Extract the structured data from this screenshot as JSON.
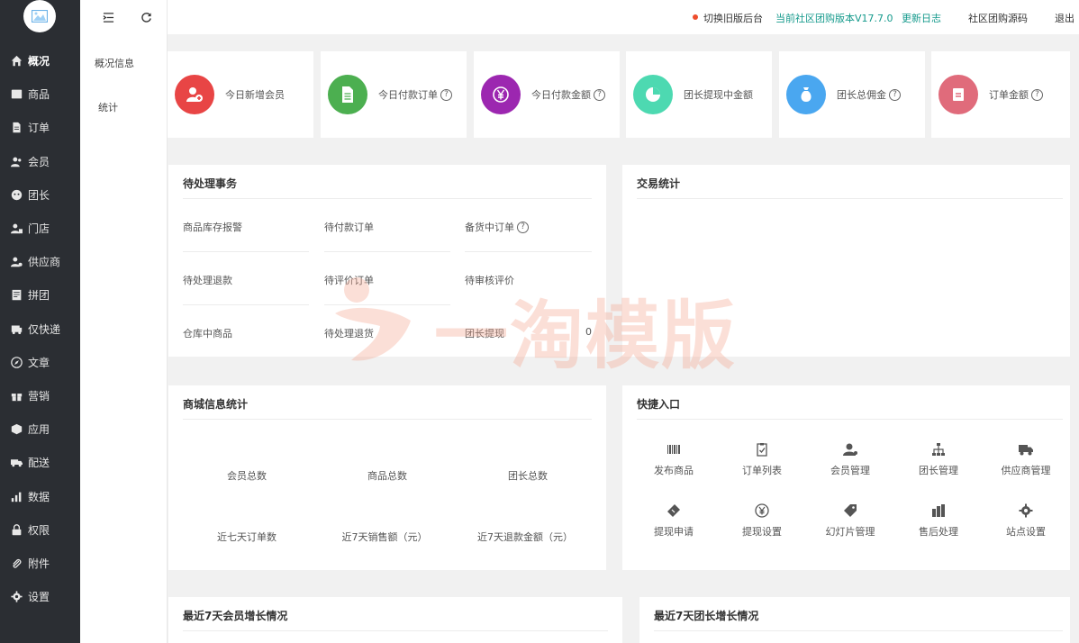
{
  "sidebar": {
    "logo_icon": "image-icon",
    "items": [
      {
        "label": "概况",
        "icon": "home-icon",
        "active": true
      },
      {
        "label": "商品",
        "icon": "goods-icon"
      },
      {
        "label": "订单",
        "icon": "order-icon"
      },
      {
        "label": "会员",
        "icon": "member-icon"
      },
      {
        "label": "团长",
        "icon": "leader-icon"
      },
      {
        "label": "门店",
        "icon": "store-icon"
      },
      {
        "label": "供应商",
        "icon": "supplier-icon"
      },
      {
        "label": "拼团",
        "icon": "group-icon"
      },
      {
        "label": "仅快递",
        "icon": "express-icon"
      },
      {
        "label": "文章",
        "icon": "article-icon"
      },
      {
        "label": "营销",
        "icon": "gift-icon"
      },
      {
        "label": "应用",
        "icon": "app-icon"
      },
      {
        "label": "配送",
        "icon": "truck-icon"
      },
      {
        "label": "数据",
        "icon": "data-icon"
      },
      {
        "label": "权限",
        "icon": "lock-icon"
      },
      {
        "label": "附件",
        "icon": "attach-icon"
      },
      {
        "label": "设置",
        "icon": "gear-icon"
      }
    ]
  },
  "submenu": {
    "items": [
      "概况信息",
      "统计"
    ]
  },
  "topbar": {
    "switch_old": "切换旧版后台",
    "version": "当前社区团购版本V17.7.0",
    "changelog": "更新日志",
    "source": "社区团购源码",
    "logout": "退出",
    "colors": {
      "link": "#159a8c",
      "dot": "#ee4d2d"
    }
  },
  "stats": [
    {
      "label": "今日新增会员",
      "color": "#e84545",
      "icon": "add-user-icon",
      "help": false
    },
    {
      "label": "今日付款订单",
      "color": "#4caf50",
      "icon": "document-icon",
      "help": true
    },
    {
      "label": "今日付款金额",
      "color": "#9c27b0",
      "icon": "yen-icon",
      "help": true
    },
    {
      "label": "团长提现中金额",
      "color": "#4dd9b1",
      "icon": "pie-icon",
      "help": false
    },
    {
      "label": "团长总佣金",
      "color": "#4aa7f0",
      "icon": "money-bag-icon",
      "help": true
    },
    {
      "label": "订单金额",
      "color": "#e06b7b",
      "icon": "receipt-icon",
      "help": true
    }
  ],
  "help_mark": "?",
  "pending": {
    "title": "待处理事务",
    "items": [
      {
        "label": "商品库存报警"
      },
      {
        "label": "待付款订单"
      },
      {
        "label": "备货中订单",
        "help": true
      },
      {
        "label": "待处理退款"
      },
      {
        "label": "待评价订单"
      },
      {
        "label": "待审核评价"
      },
      {
        "label": "仓库中商品"
      },
      {
        "label": "待处理退货"
      },
      {
        "label": "团长提现",
        "value": "0"
      }
    ]
  },
  "trade": {
    "title": "交易统计"
  },
  "mall": {
    "title": "商城信息统计",
    "items": [
      "会员总数",
      "商品总数",
      "团长总数",
      "近七天订单数",
      "近7天销售额（元）",
      "近7天退款金额（元）"
    ]
  },
  "quick": {
    "title": "快捷入口",
    "items": [
      {
        "label": "发布商品",
        "icon": "barcode-icon"
      },
      {
        "label": "订单列表",
        "icon": "clipboard-check-icon"
      },
      {
        "label": "会员管理",
        "icon": "member-manage-icon"
      },
      {
        "label": "团长管理",
        "icon": "sitemap-icon"
      },
      {
        "label": "供应商管理",
        "icon": "truck-icon"
      },
      {
        "label": "提现申请",
        "icon": "ticket-icon"
      },
      {
        "label": "提现设置",
        "icon": "yen-circle-icon"
      },
      {
        "label": "幻灯片管理",
        "icon": "tag-icon"
      },
      {
        "label": "售后处理",
        "icon": "bars-icon"
      },
      {
        "label": "站点设置",
        "icon": "gear-icon"
      }
    ]
  },
  "member_growth": {
    "title": "最近7天会员增长情况"
  },
  "leader_growth": {
    "title": "最近7天团长增长情况"
  },
  "watermark": {
    "text": "一淘模版"
  }
}
